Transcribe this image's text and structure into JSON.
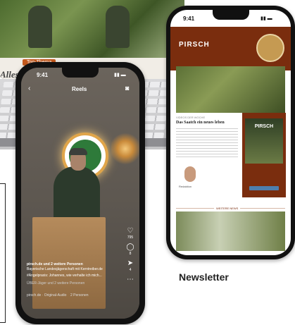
{
  "laptop": {
    "badge_label": "Top-Thema",
    "headline_fragment": "Alles"
  },
  "left_phone": {
    "status_time": "9:41",
    "screen_title": "Reels",
    "sidebar_counts": [
      "795",
      "8",
      "4"
    ],
    "caption_line1": "pirsch.de und 2 weitere Personen",
    "caption_line2": "Bayerische Landesjägerschaft mit Kerntreiber.de",
    "caption_line3": "#Angelpraxis: Johannes, wie verhalte ich mich...",
    "caption_line4": "ÜBER-Jäger und 2 weitere Personen",
    "audio_label": "pirsch.de · Original-Audio",
    "persons_label": "2 Personen"
  },
  "right_phone": {
    "status_time": "9:41",
    "brand": "PIRSCH",
    "article_kicker": "VIDEOS DER WOCHE",
    "article_title": "Das Saatch ein neues leben",
    "sign_name": "Redaktion",
    "magazine_brand": "PIRSCH",
    "weitere_label": "WEITERE NEWS"
  },
  "caption": {
    "label": "Newsletter"
  },
  "colors": {
    "brand_red": "#7a2d0e",
    "accent_orange": "#c45a1e",
    "logo_green": "#2e7a3a"
  }
}
